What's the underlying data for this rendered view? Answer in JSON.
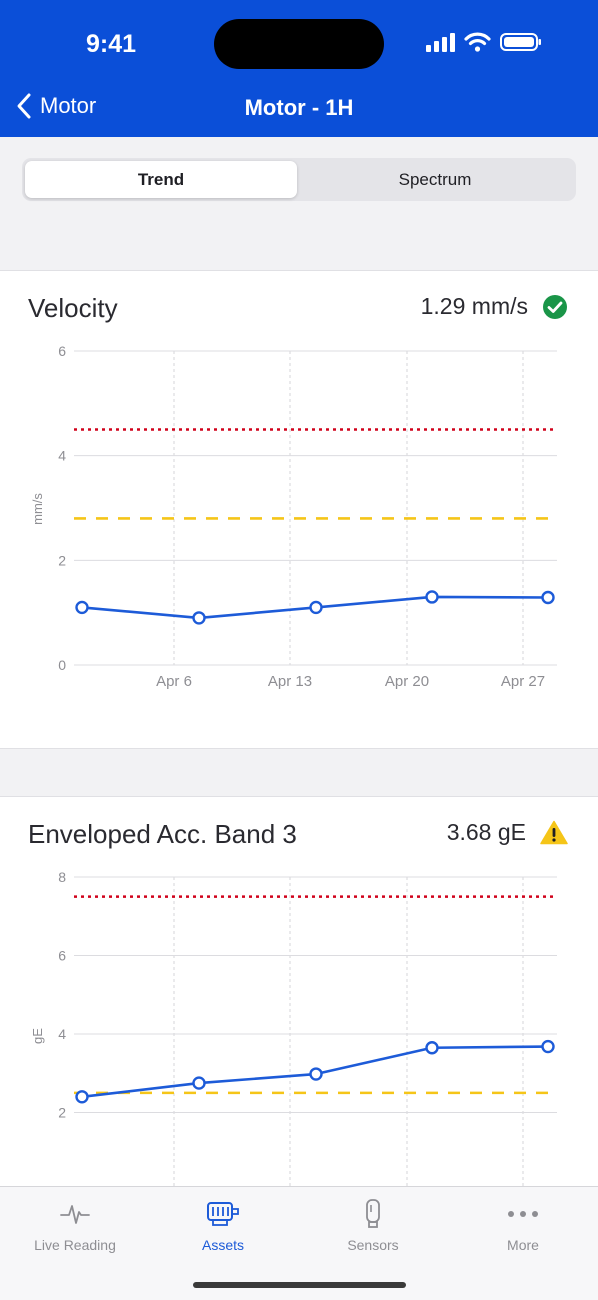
{
  "status_bar": {
    "time": "9:41"
  },
  "nav": {
    "back_label": "Motor",
    "title": "Motor - 1H"
  },
  "segments": {
    "trend": "Trend",
    "spectrum": "Spectrum",
    "selected": "Trend"
  },
  "cards": [
    {
      "title": "Velocity",
      "value": "1.29 mm/s",
      "status_icon": "check-circle-icon",
      "status_color": "#1a9548"
    },
    {
      "title": "Enveloped Acc. Band 3",
      "value": "3.68 gE",
      "status_icon": "warning-triangle-icon",
      "status_color": "#f5c518"
    }
  ],
  "chart_data": [
    {
      "type": "line",
      "ylabel": "mm/s",
      "ylim": [
        0,
        6
      ],
      "yticks": [
        "0",
        "2",
        "4",
        "6"
      ],
      "xticks": [
        "Apr 6",
        "Apr 13",
        "Apr 20",
        "Apr 27"
      ],
      "series": [
        {
          "x": [
            "Mar 30",
            "Apr 6",
            "Apr 13",
            "Apr 20",
            "Apr 27"
          ],
          "values": [
            1.1,
            0.9,
            1.1,
            1.3,
            1.29
          ]
        }
      ],
      "thresholds": [
        {
          "value": 4.5,
          "color": "#d0021b",
          "style": "dotted"
        },
        {
          "value": 2.8,
          "color": "#f5c518",
          "style": "dashed"
        }
      ],
      "grid": true,
      "line_color": "#1d5bd8"
    },
    {
      "type": "line",
      "ylabel": "gE",
      "ylim": [
        0,
        8
      ],
      "yticks": [
        "2",
        "4",
        "6",
        "8"
      ],
      "xticks": [],
      "series": [
        {
          "x": [
            "Mar 30",
            "Apr 6",
            "Apr 13",
            "Apr 20",
            "Apr 27"
          ],
          "values": [
            2.4,
            2.75,
            2.98,
            3.65,
            3.68
          ]
        }
      ],
      "thresholds": [
        {
          "value": 7.5,
          "color": "#d0021b",
          "style": "dotted"
        },
        {
          "value": 2.5,
          "color": "#f5c518",
          "style": "dashed"
        }
      ],
      "grid": true,
      "line_color": "#1d5bd8"
    }
  ],
  "tabbar": {
    "items": [
      {
        "label": "Live Reading",
        "icon": "pulse-icon"
      },
      {
        "label": "Assets",
        "icon": "motor-icon",
        "active": true
      },
      {
        "label": "Sensors",
        "icon": "sensor-icon"
      },
      {
        "label": "More",
        "icon": "more-icon"
      }
    ]
  }
}
